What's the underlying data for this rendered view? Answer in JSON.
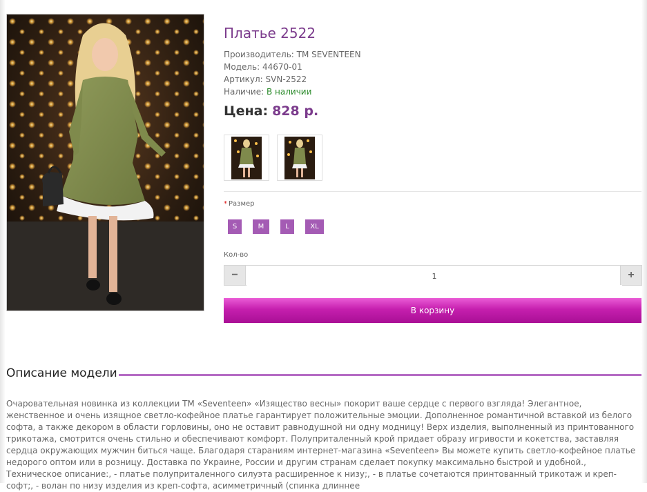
{
  "product": {
    "title": "Платье 2522",
    "manufacturer_label": "Производитель:",
    "manufacturer": "TM SEVENTEEN",
    "model_label": "Модель:",
    "model": "44670-01",
    "sku_label": "Артикул:",
    "sku": "SVN-2522",
    "availability_label": "Наличие:",
    "availability": "В наличии",
    "price_label": "Цена:",
    "price": "828 р."
  },
  "options": {
    "required_mark": "*",
    "size_label": "Размер",
    "sizes": [
      "S",
      "M",
      "L",
      "XL"
    ]
  },
  "quantity": {
    "label": "Кол-во",
    "value": "1",
    "minus": "−",
    "plus": "+"
  },
  "cart": {
    "button_label": "В корзину"
  },
  "description": {
    "title": "Описание модели",
    "text": "Очаровательная новинка из коллекции ТМ «Seventeen» «Изящество весны» покорит ваше сердце с первого взгляда! Элегантное, женственное и очень изящное светло-кофейное платье гарантирует положительные эмоции. Дополненное романтичной вставкой из белого софта, а также декором в области горловины, оно не оставит равнодушной ни одну модницу! Верх изделия, выполненный из принтованного трикотажа, смотрится очень стильно и обеспечивают комфорт. Полуприталенный крой придает образу игривости и кокетства, заставляя сердца окружающих мужчин биться чаще. Благодаря стараниям интернет-магазина «Seventeen» Вы можете купить светло-кофейное платье недорого оптом или в розницу. Доставка по Украине, России и другим странам сделает покупку максимально быстрой и удобной., Техническое описание:, - платье полуприталенного силуэта расширенное к низу;, - в платье сочетаются принтованный трикотаж и креп-софт;, - волан по низу изделия из креп-софта, асимметричный (спинка длиннее"
  },
  "colors": {
    "accent": "#7b3b8c",
    "size_button": "#a45bb4",
    "cart_gradient_top": "#ea5cd6",
    "cart_gradient_bottom": "#a90f95",
    "in_stock": "#2a8a2a",
    "divider": "#b56cc4"
  }
}
